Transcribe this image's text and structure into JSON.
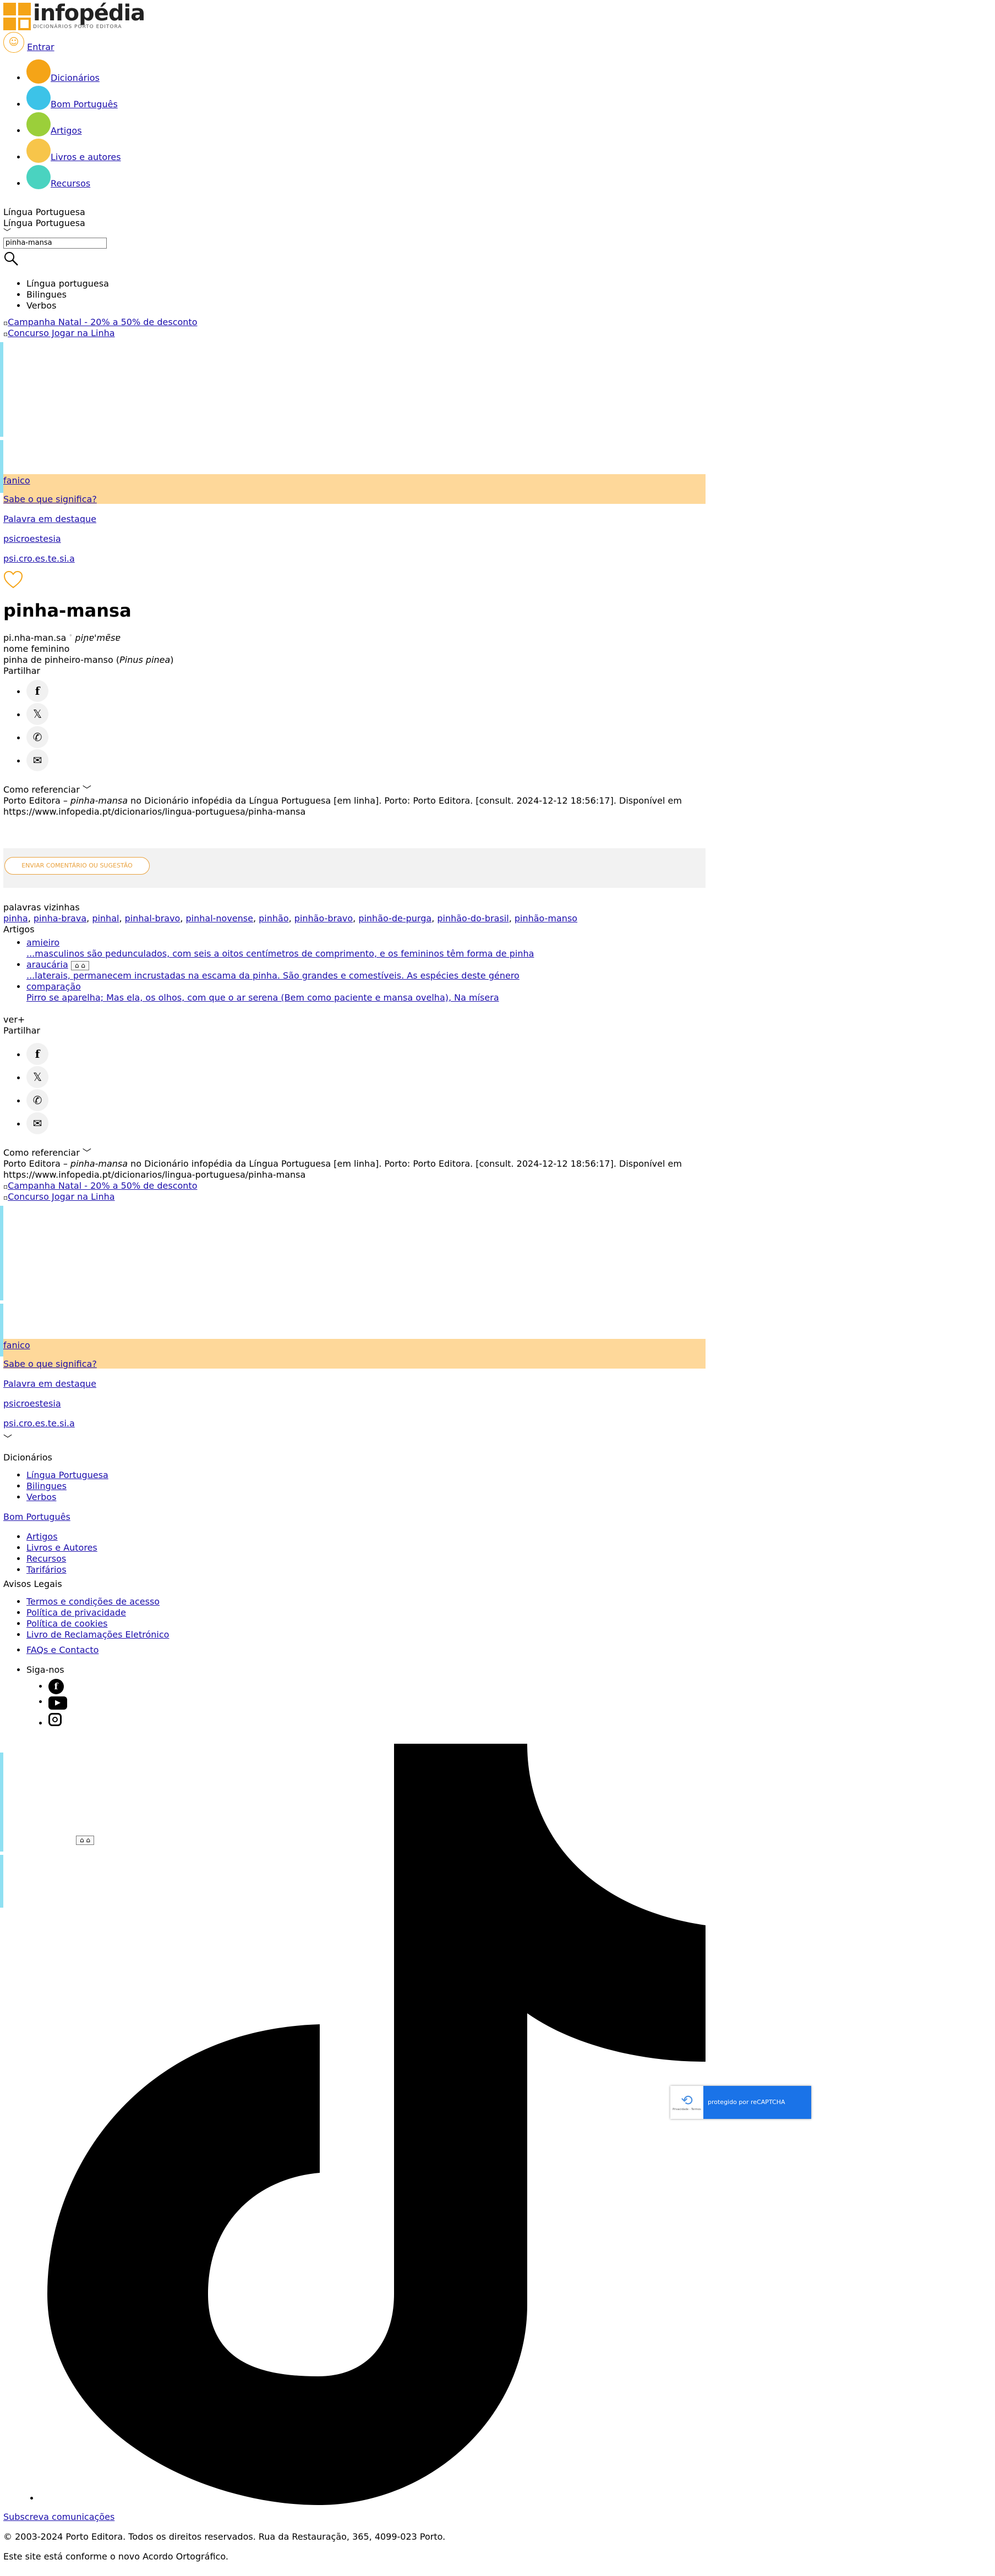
{
  "header": {
    "logo_title": "infopédia",
    "logo_subtitle": "DICIONÁRIOS PORTO EDITORA",
    "login_label": "Entrar"
  },
  "nav": [
    {
      "label": "Dicionários",
      "color": "#f5a417"
    },
    {
      "label": "Bom Português",
      "color": "#3cc3e8"
    },
    {
      "label": "Artigos",
      "color": "#9bcf3a"
    },
    {
      "label": "Livros e autores",
      "color": "#f7c54a"
    },
    {
      "label": "Recursos",
      "color": "#4ad3c0"
    }
  ],
  "search": {
    "dict_selected": "Língua Portuguesa",
    "dict_selected_2": "Língua Portuguesa",
    "query": "pinha-mansa",
    "options": [
      "Língua portuguesa",
      "Bilingues",
      "Verbos"
    ]
  },
  "banners": {
    "banner1": "Campanha Natal - 20% a 50% de desconto",
    "banner2": "Concurso Jogar na Linha"
  },
  "word_feature": {
    "word_link": "fanico",
    "question": "Sabe o que significa?",
    "featured_label": "Palavra em destaque",
    "featured_word": "psicroestesia",
    "featured_syll": "psi.cro.es.te.si.a"
  },
  "entry": {
    "headword": "pinha-mansa",
    "syllabification": "pi.nha-man.sa",
    "pronunciation": "piɲɐ'mɐ̃sɐ",
    "grammar": "nome feminino",
    "definition_prefix": "pinha de pinheiro-manso (",
    "definition_latin": "Pinus pinea",
    "definition_suffix": ")",
    "share_label": "Partilhar",
    "cite_label": "Como referenciar",
    "cite_prefix": "Porto Editora – ",
    "cite_word": "pinha-mansa",
    "cite_text": " no Dicionário infopédia da Língua Portuguesa [em linha]. Porto: Porto Editora. [consult. 2024-12-12 18:56:17]. Disponível em",
    "cite_url": "https://www.infopedia.pt/dicionarios/lingua-portuguesa/pinha-mansa",
    "comment_button": "ENVIAR COMENTÁRIO OU SUGESTÃO"
  },
  "neighbors": {
    "title": "palavras vizinhas",
    "words": [
      "pinha",
      "pinha-brava",
      "pinhal",
      "pinhal-bravo",
      "pinhal-novense",
      "pinhão",
      "pinhão-bravo",
      "pinhão-de-purga",
      "pinhão-do-brasil",
      "pinhão-manso"
    ]
  },
  "articles": {
    "title": "Artigos",
    "items": [
      {
        "title": "amieiro",
        "excerpt": "...masculinos são pedunculados, com seis a oitos centímetros de comprimento, e os femininos têm forma de pinha"
      },
      {
        "title": "araucária",
        "excerpt": "...laterais, permanecem incrustadas na escama da pinha. São grandes e comestíveis. As espécies deste género"
      },
      {
        "title": "comparação",
        "excerpt": "Pirro se aparelha; Mas ela, os olhos, com que o ar serena (Bem como paciente e mansa ovelha), Na mísera"
      }
    ],
    "see_more": "ver+"
  },
  "footer": {
    "dict_title": "Dicionários",
    "dict_items": [
      "Língua Portuguesa",
      "Bilingues",
      "Verbos"
    ],
    "bom_portugues": "Bom Português",
    "other_items": [
      "Artigos",
      "Livros e Autores",
      "Recursos",
      "Tarifários"
    ],
    "legal_title": "Avisos Legais",
    "legal_items": [
      "Termos e condições de acesso",
      "Política de privacidade",
      "Política de cookies",
      "Livro de Reclamações Eletrónico"
    ],
    "faq": "FAQs e Contacto",
    "follow": "Siga-nos",
    "subscribe": "Subscreva comunicações",
    "copyright": "© 2003-2024 Porto Editora. Todos os direitos reservados. Rua da Restauração, 365, 4099-023 Porto.",
    "acordo": "Este site está conforme o novo Acordo Ortográfico."
  },
  "recaptcha": {
    "label": "protegido por reCAPTCHA",
    "sub": "Privacidade - Termos"
  }
}
